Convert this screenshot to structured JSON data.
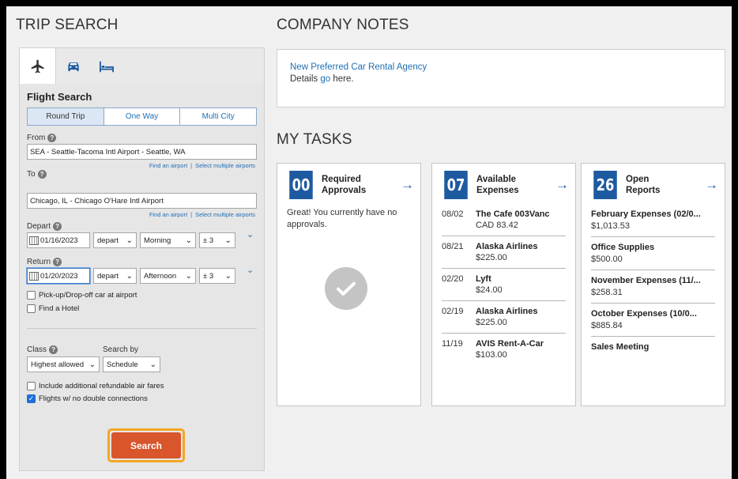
{
  "headings": {
    "trip_search": "TRIP SEARCH",
    "company_notes": "COMPANY NOTES",
    "my_tasks": "MY TASKS"
  },
  "trip_tabs": [
    {
      "icon": "airplane-icon",
      "active": true
    },
    {
      "icon": "car-icon",
      "active": false
    },
    {
      "icon": "hotel-bed-icon",
      "active": false
    }
  ],
  "flight_search": {
    "title": "Flight Search",
    "trip_types": [
      "Round Trip",
      "One Way",
      "Multi City"
    ],
    "selected_trip_type": "Round Trip",
    "from_label": "From",
    "from_value": "SEA - Seattle-Tacoma Intl Airport - Seattle, WA",
    "to_label": "To",
    "to_value": "Chicago, IL - Chicago O'Hare Intl Airport",
    "find_airport": "Find an airport",
    "select_multiple": "Select multiple airports",
    "depart_label": "Depart",
    "depart_date": "01/16/2023",
    "depart_type": "depart",
    "depart_time": "Morning",
    "depart_window": "± 3",
    "return_label": "Return",
    "return_date": "01/20/2023",
    "return_type": "depart",
    "return_time": "Afternoon",
    "return_window": "± 3",
    "pickup_car": "Pick-up/Drop-off car at airport",
    "find_hotel": "Find a Hotel",
    "class_label": "Class",
    "class_value": "Highest allowed",
    "search_by_label": "Search by",
    "search_by_value": "Schedule",
    "include_refundable": "Include additional refundable air fares",
    "no_double_connections": "Flights w/ no double connections",
    "no_double_checked": true,
    "search_button": "Search"
  },
  "company_notes": {
    "line1": "New Preferred Car Rental Agency",
    "line2_prefix": "Details ",
    "line2_link": "go",
    "line2_suffix": " here."
  },
  "tasks": {
    "approvals": {
      "count": "00",
      "title_line1": "Required",
      "title_line2": "Approvals",
      "message": "Great! You currently have no approvals."
    },
    "expenses": {
      "count": "07",
      "title_line1": "Available",
      "title_line2": "Expenses",
      "items": [
        {
          "date": "08/02",
          "name": "The Cafe 003Vanc",
          "amount": "CAD 83.42"
        },
        {
          "date": "08/21",
          "name": "Alaska Airlines",
          "amount": "$225.00"
        },
        {
          "date": "02/20",
          "name": "Lyft",
          "amount": "$24.00"
        },
        {
          "date": "02/19",
          "name": "Alaska Airlines",
          "amount": "$225.00"
        },
        {
          "date": "11/19",
          "name": "AVIS Rent-A-Car",
          "amount": "$103.00"
        }
      ]
    },
    "reports": {
      "count": "26",
      "title_line1": "Open",
      "title_line2": "Reports",
      "items": [
        {
          "name": "February Expenses (02/0...",
          "amount": "$1,013.53"
        },
        {
          "name": "Office Supplies",
          "amount": "$500.00"
        },
        {
          "name": "November Expenses (11/...",
          "amount": "$258.31"
        },
        {
          "name": "October Expenses (10/0...",
          "amount": "$885.84"
        },
        {
          "name": "Sales Meeting",
          "amount": ""
        }
      ]
    }
  },
  "colors": {
    "accent_blue": "#1e5aa0",
    "link_blue": "#1f6fb5",
    "search_orange": "#d9552b",
    "highlight_ring": "#f5a623"
  }
}
